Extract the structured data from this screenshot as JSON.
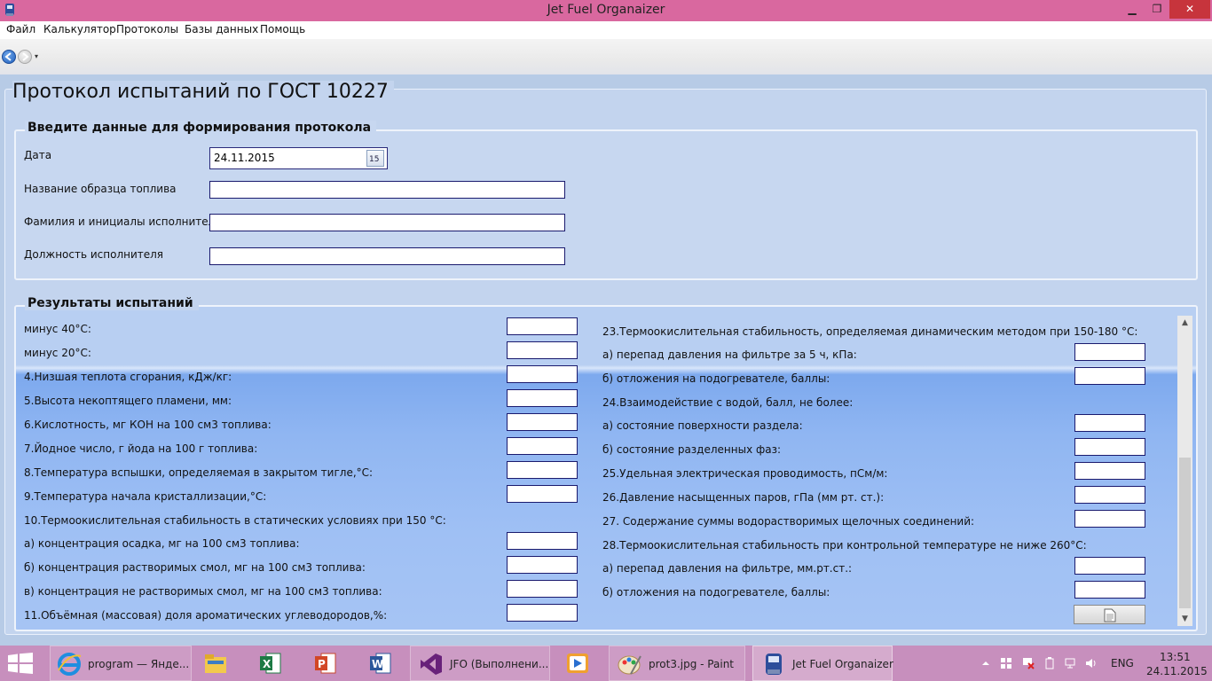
{
  "window": {
    "title": "Jet Fuel Organaizer",
    "controls": {
      "minimize": "▁",
      "maximize": "❐",
      "close": "✕"
    }
  },
  "menu": [
    "Файл",
    "Калькулятор",
    "Протоколы",
    "Базы данных",
    "Помощь"
  ],
  "nav": {
    "back": "back-icon",
    "forward": "forward-icon",
    "dropdown": "▾"
  },
  "page": {
    "title": "Протокол испытаний по ГОСТ 10227",
    "input_group": {
      "title": "Введите данные для формирования протокола",
      "fields": [
        {
          "label": "Дата",
          "value": "24.11.2015"
        },
        {
          "label": "Название образца топлива",
          "value": ""
        },
        {
          "label": "Фамилия и инициалы исполнителя",
          "value": ""
        },
        {
          "label": "Должность исполнителя",
          "value": ""
        }
      ]
    },
    "results_group": {
      "title": "Результаты испытаний",
      "left": [
        {
          "label": "минус 40°С:",
          "input": true
        },
        {
          "label": "минус 20°С:",
          "input": true
        },
        {
          "label": "4.Низшая теплота сгорания, кДж/кг:",
          "input": true
        },
        {
          "label": "5.Высота некоптящего пламени, мм:",
          "input": true
        },
        {
          "label": "6.Кислотность, мг КОН на 100 см3 топлива:",
          "input": true
        },
        {
          "label": "7.Йодное число, г йода на 100 г топлива:",
          "input": true
        },
        {
          "label": "8.Температура вспышки, определяемая в закрытом тигле,°С:",
          "input": true
        },
        {
          "label": "9.Температура начала кристаллизации,°С:",
          "input": true
        },
        {
          "label": "10.Термоокислительная стабильность в статических условиях при 150 °С:",
          "input": false
        },
        {
          "label": "а) концентрация осадка, мг на 100 см3 топлива:",
          "input": true
        },
        {
          "label": "б) концентрация растворимых смол, мг на 100 см3 топлива:",
          "input": true
        },
        {
          "label": "в) концентрация не растворимых смол, мг на 100 см3 топлива:",
          "input": true
        },
        {
          "label": "11.Объёмная (массовая) доля ароматических углеводородов,%:",
          "input": true
        }
      ],
      "right": [
        {
          "label": "23.Термоокислительная стабильность, определяемая динамическим методом при 150-180 °С:",
          "input": false
        },
        {
          "label": "а) перепад давления на фильтре за 5 ч, кПа:",
          "input": true
        },
        {
          "label": "б) отложения на подогревателе, баллы:",
          "input": true
        },
        {
          "label": "24.Взаимодействие с водой, балл, не более:",
          "input": false
        },
        {
          "label": "а) состояние поверхности раздела:",
          "input": true
        },
        {
          "label": "б) состояние разделенных фаз:",
          "input": true
        },
        {
          "label": "25.Удельная электрическая проводимость, пСм/м:",
          "input": true
        },
        {
          "label": "26.Давление насыщенных паров, гПа (мм рт. ст.):",
          "input": true
        },
        {
          "label": "27. Содержание суммы водорастворимых щелочных соединений:",
          "input": true
        },
        {
          "label": "28.Термоокислительная стабильность при контрольной температуре не ниже 260°С:",
          "input": false
        },
        {
          "label": "а) перепад давления на фильтре, мм.рт.ст.:",
          "input": true
        },
        {
          "label": "б) отложения на подогревателе, баллы:",
          "input": true
        }
      ],
      "document_button": "document-icon"
    }
  },
  "taskbar": {
    "items": [
      {
        "label": "program — Янде...",
        "icon": "ie-icon"
      },
      {
        "label": "",
        "icon": "file-explorer-icon"
      },
      {
        "label": "",
        "icon": "excel-icon"
      },
      {
        "label": "",
        "icon": "powerpoint-icon"
      },
      {
        "label": "",
        "icon": "word-icon"
      },
      {
        "label": "JFO (Выполнени...",
        "icon": "visual-studio-icon"
      },
      {
        "label": "",
        "icon": "media-player-icon"
      },
      {
        "label": "prot3.jpg - Paint",
        "icon": "paint-icon"
      },
      {
        "label": "Jet Fuel Organaizer",
        "icon": "jfo-app-icon"
      }
    ],
    "tray": {
      "language": "ENG",
      "time": "13:51",
      "date": "24.11.2015"
    }
  },
  "colors": {
    "titlebar": "#d9689f",
    "taskbar": "#c78fbd",
    "panel": "#c3d4ee",
    "close": "#c7343c"
  }
}
